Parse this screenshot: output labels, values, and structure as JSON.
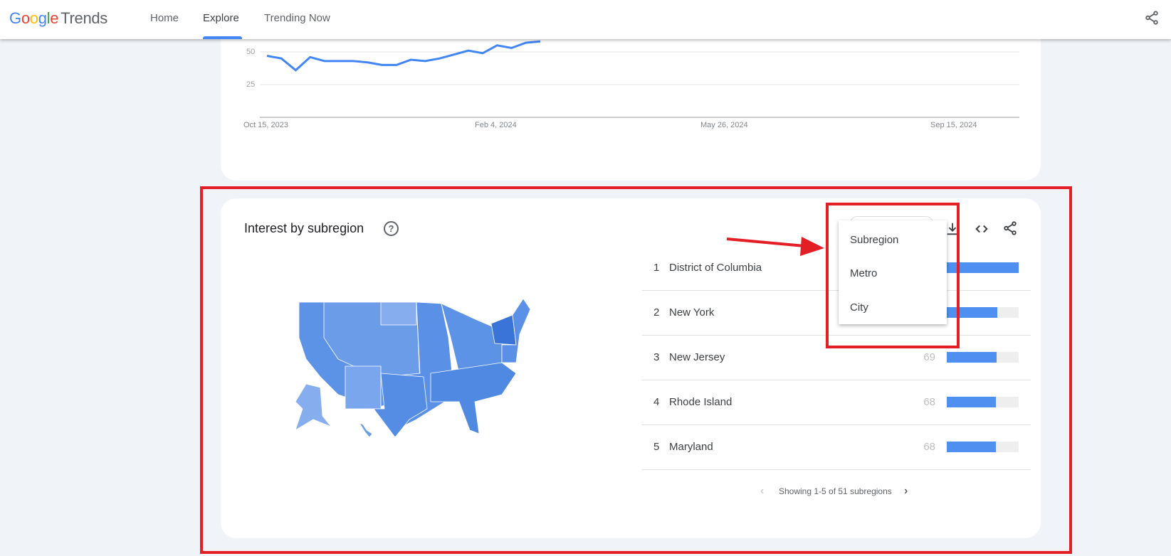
{
  "header": {
    "logo": {
      "g1": "G",
      "g2": "o",
      "g3": "o",
      "g4": "g",
      "g5": "l",
      "g6": "e",
      "product": "Trends"
    },
    "nav": [
      {
        "label": "Home"
      },
      {
        "label": "Explore",
        "active": true
      },
      {
        "label": "Trending Now"
      }
    ],
    "share_icon": "share-icon"
  },
  "chart_data": {
    "type": "line",
    "x": [
      "2023-10-15",
      "2023-10-22",
      "2023-10-29",
      "2023-11-05",
      "2023-11-12",
      "2023-11-19",
      "2023-11-26",
      "2023-12-03",
      "2023-12-10",
      "2023-12-17",
      "2023-12-24",
      "2023-12-31",
      "2024-01-07",
      "2024-01-14",
      "2024-01-21",
      "2024-01-28",
      "2024-02-04",
      "2024-02-11",
      "2024-02-18",
      "2024-02-25"
    ],
    "series": [
      {
        "values": [
          47,
          45,
          36,
          46,
          43,
          43,
          43,
          42,
          40,
          40,
          44,
          43,
          45,
          48,
          51,
          49,
          55,
          53,
          57,
          58
        ],
        "color": "#4285f4"
      }
    ],
    "y_ticks": [
      "50",
      "25"
    ],
    "x_ticks": [
      "Oct 15, 2023",
      "Feb 4, 2024",
      "May 26, 2024",
      "Sep 15, 2024"
    ],
    "grid": true
  },
  "subregion": {
    "title": "Interest by subregion",
    "help_icon": "?",
    "rows": [
      {
        "rank": "1",
        "name": "District of Columbia",
        "value": "",
        "fill": 100
      },
      {
        "rank": "2",
        "name": "New York",
        "value": "",
        "fill": 70
      },
      {
        "rank": "3",
        "name": "New Jersey",
        "value": "69",
        "fill": 69
      },
      {
        "rank": "4",
        "name": "Rhode Island",
        "value": "68",
        "fill": 68
      },
      {
        "rank": "5",
        "name": "Maryland",
        "value": "68",
        "fill": 68
      }
    ],
    "pager": "Showing 1-5 of 51 subregions",
    "dropdown": [
      "Subregion",
      "Metro",
      "City"
    ],
    "bar_color": "#4f8ff0",
    "highlight_state_color": "#3b74d8",
    "annotation_color": "#e31e24"
  }
}
